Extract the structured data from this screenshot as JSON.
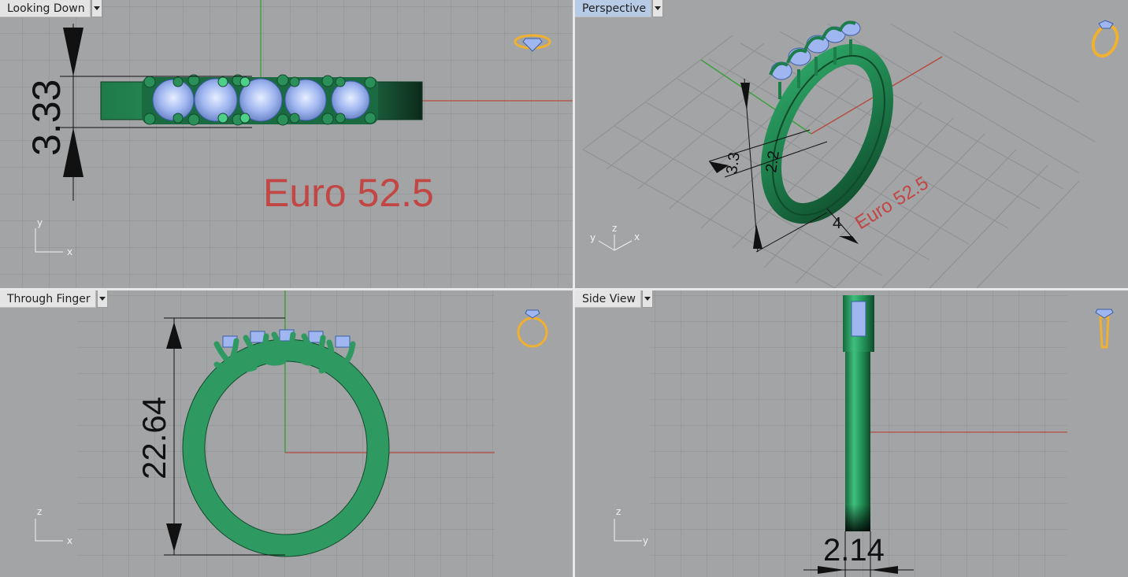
{
  "viewports": [
    {
      "id": "top",
      "label": "Looking Down",
      "active": false,
      "dimension": "3.33",
      "note": "Euro 52.5",
      "axes": {
        "v": "y",
        "h": "x"
      }
    },
    {
      "id": "perspective",
      "label": "Perspective",
      "active": true,
      "dimension_a": "3.3",
      "dimension_b": "2.2",
      "dimension_c": "4",
      "note": "Euro 52.5",
      "axes": {
        "a": "z",
        "b": "y",
        "c": "x"
      }
    },
    {
      "id": "front",
      "label": "Through Finger",
      "active": false,
      "dimension": "22.64",
      "axes": {
        "v": "z",
        "h": "x"
      }
    },
    {
      "id": "side",
      "label": "Side View",
      "active": false,
      "dimension": "2.14",
      "axes": {
        "v": "z",
        "h": "y"
      }
    }
  ],
  "colors": {
    "background": "#a3a4a6",
    "grid": "#8c8d8f",
    "ring": "#2e9a62",
    "stone": "#9fb6f0",
    "x_axis": "#b44a40",
    "y_axis": "#3aa03a",
    "note_text": "#c24644",
    "widget": "#f0b030"
  },
  "icons": [
    "ring-top-icon",
    "ring-perspective-icon",
    "ring-front-icon",
    "ring-side-icon",
    "viewport-menu-arrow-icon"
  ]
}
